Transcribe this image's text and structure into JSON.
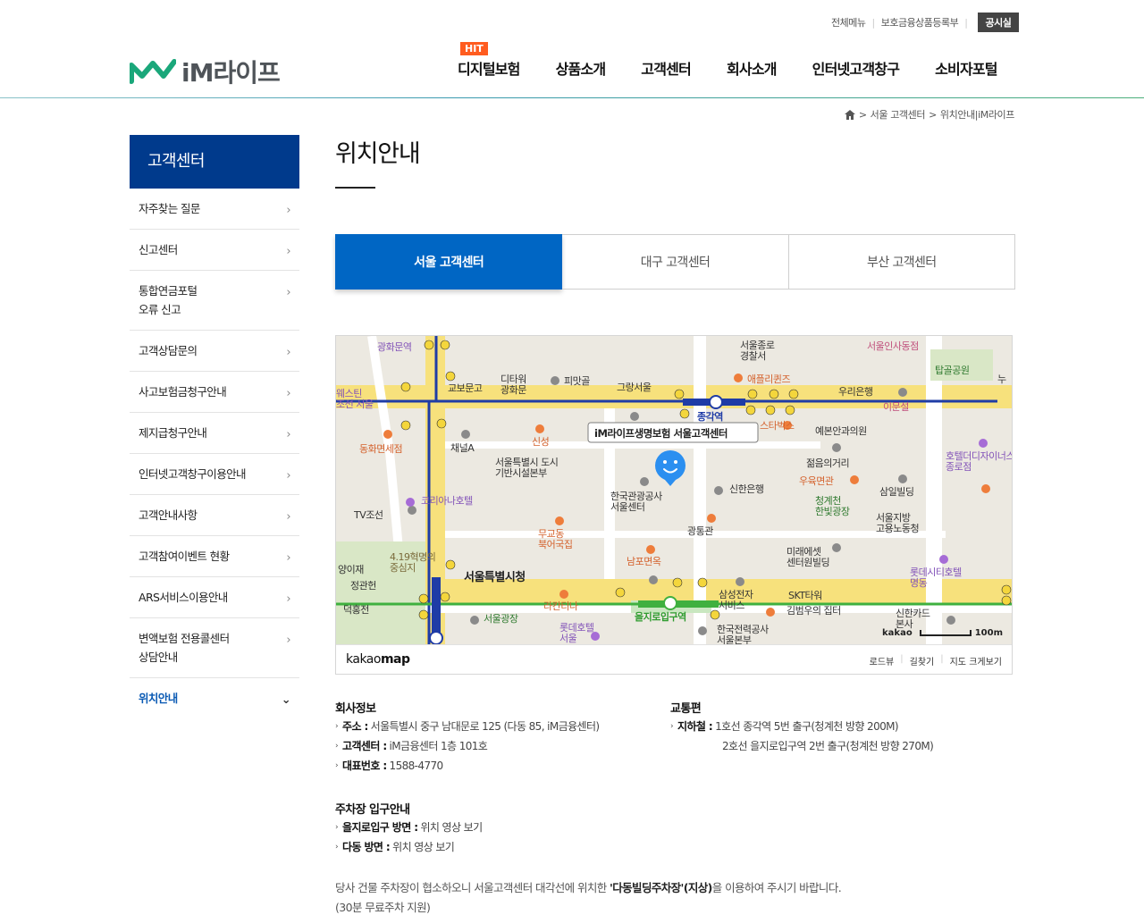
{
  "util": {
    "all_menu": "전체메뉴",
    "product_reg": "보호금융상품등록부",
    "notice": "공시실"
  },
  "logo": {
    "brand": "iM라이프"
  },
  "gnb": {
    "hit": "HIT",
    "items": [
      "디지털보험",
      "상품소개",
      "고객센터",
      "회사소개",
      "인터넷고객창구",
      "소비자포털"
    ]
  },
  "breadcrumb": {
    "level1": "서울 고객센터",
    "level2": "위치안내|iM라이프"
  },
  "snb": {
    "title": "고객센터",
    "items": [
      "자주찾는 질문",
      "신고센터",
      "통합연금포털\n오류 신고",
      "고객상담문의",
      "사고보험금청구안내",
      "제지급청구안내",
      "인터넷고객창구이용안내",
      "고객안내사항",
      "고객참여이벤트 현황",
      "ARS서비스이용안내",
      "변액보험 전용콜센터\n상담안내",
      "위치안내"
    ]
  },
  "page": {
    "title": "위치안내"
  },
  "tabs": [
    "서울 고객센터",
    "대구 고객센터",
    "부산 고객센터"
  ],
  "map": {
    "pin_label": "iM라이프생명보험 서울고객센터",
    "labels": {
      "police": "서울종로\n경찰서",
      "insadong": "서울인사동점",
      "tapgol": "탑골공원",
      "kyobo": "교보문고",
      "dtower": "디타워\n광화문",
      "pimatgol": "피맛골",
      "grand_seoul": "그랑서울",
      "apple": "애플리퀸즈",
      "woori": "우리은행",
      "jonggak": "종각역",
      "starbucks": "스타벅스",
      "yebon": "예본안과의원",
      "hotel_design": "호텔더디자이너스\n종로점",
      "donghwa": "동화면세점",
      "chaenel": "채널A",
      "sinsung": "신성",
      "city_facility": "서울특별시 도시\n기반시설본부",
      "koreana": "코리아나호텔",
      "kto": "한국관광공사\n서울센터",
      "shinhan": "신한은행",
      "youth": "젊음의거리",
      "uok": "우육면관",
      "chunggye": "청계천\n한빛광장",
      "samil": "삼일빌딩",
      "tv": "TV조선",
      "mugyo": "무교동\n북어국집",
      "gwangtong": "광통관",
      "labor": "서울지방\n고용노동청",
      "hotel_lotte_city": "롯데시티호텔\n명동",
      "future": "미래에셋\n센터원빌딩",
      "nampo": "남포면옥",
      "city_hall": "서울특별시청",
      "april19": "4.19혁명의\n중심지",
      "seoul_plaza": "서울광장",
      "lacanti": "라칸티나",
      "samsung": "삼성전자\n서비스",
      "skt": "SKT타워",
      "kimbum": "김범우의 집터",
      "shinhan_card": "신한카드\n본사",
      "lotte_hotel": "롯데호텔\n서울",
      "kepco": "한국전력공사\n서울본부",
      "euljiro": "을지로입구역",
      "deokhong": "덕홍전",
      "yangijae": "양이재",
      "jeonggwan": "정관헌",
      "westin": "웨스틴\n조선 서울",
      "gwanghwamun": "광화문역",
      "ieumun": "이문설",
      "nu": "누"
    },
    "kakao": "kakao",
    "scale": "100m",
    "footer_brand_a": "kakao",
    "footer_brand_b": "map",
    "links": [
      "로드뷰",
      "길찾기",
      "지도 크게보기"
    ]
  },
  "company": {
    "heading": "회사정보",
    "address_label": "주소 :",
    "address": "서울특별시 중구 남대문로 125 (다동 85, iM금융센터)",
    "center_label": "고객센터 :",
    "center": "iM금융센터 1층 101호",
    "phone_label": "대표번호 :",
    "phone": "1588-4770"
  },
  "transit": {
    "heading": "교통편",
    "subway_label": "지하철 :",
    "line1": "1호선 종각역 5번 출구(청계천 방향 200M)",
    "line2": "2호선 을지로입구역 2번 출구(청계천 방향 270M)"
  },
  "parking": {
    "heading": "주차장 입구안내",
    "euljiro_label": "을지로입구 방면 :",
    "euljiro_link": "위치 영상 보기",
    "dadong_label": "다동 방면 :",
    "dadong_link": "위치 영상 보기",
    "note_a": "당사 건물 주차장이 협소하오니 서울고객센터 대각선에 위치한 ",
    "note_b": "'다동빌딩주차장'(지상)",
    "note_c": "을 이용하여 주시기 바랍니다.",
    "note_free": "(30분 무료주차 지원)"
  },
  "colors": {
    "brand_navy": "#003a8c",
    "tab_blue": "#0066c4",
    "hit_orange": "#ff5c1f",
    "logo_green": "#1aa77a"
  }
}
